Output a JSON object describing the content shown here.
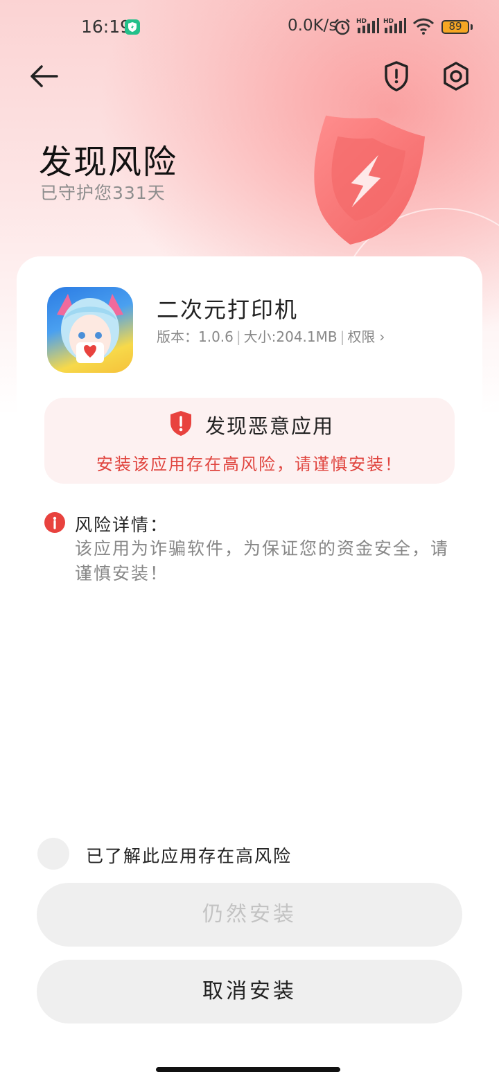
{
  "status_bar": {
    "time": "16:19",
    "network_speed": "0.0K/s",
    "signal_label_1": "HD",
    "signal_label_2": "HD",
    "battery_level": "89",
    "icons": [
      "shield-badge-icon",
      "alarm-icon",
      "signal-icon",
      "signal-icon",
      "wifi-icon",
      "battery-icon"
    ]
  },
  "nav": {
    "icons": [
      "back-arrow-icon",
      "risk-shield-icon",
      "settings-gear-icon"
    ]
  },
  "header": {
    "title": "发现风险",
    "subtitle": "已守护您331天"
  },
  "app": {
    "name": "二次元打印机",
    "version_label": "版本：1.0.6",
    "size_label": "大小:204.1MB",
    "permissions_label": "权限",
    "separator": "|"
  },
  "alert": {
    "title": "发现恶意应用",
    "description": "安装该应用存在高风险，请谨慎安装！"
  },
  "details": {
    "title": "风险详情：",
    "text": "该应用为诈骗软件，为保证您的资金安全，请谨慎安装！"
  },
  "acknowledge": {
    "label": "已了解此应用存在高风险",
    "checked": false
  },
  "buttons": {
    "install_anyway": "仍然安装",
    "cancel_install": "取消安装"
  },
  "colors": {
    "danger": "#e8423e",
    "alert_text": "#e0453f",
    "alert_bg": "#fdf1f1",
    "button_bg": "#efefef",
    "hero_pink": "#fbd3d3"
  }
}
